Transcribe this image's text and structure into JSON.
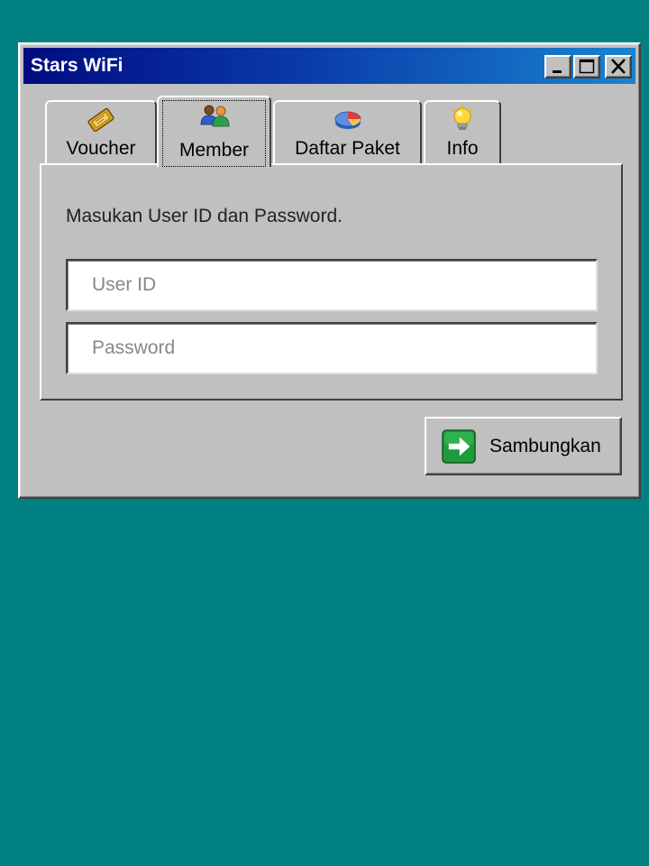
{
  "window": {
    "title": "Stars WiFi"
  },
  "titlebar_buttons": {
    "minimize_icon": "minimize-icon",
    "maximize_icon": "maximize-icon",
    "close_icon": "close-icon"
  },
  "tabs": [
    {
      "label": "Voucher",
      "icon": "ticket-icon",
      "active": false
    },
    {
      "label": "Member",
      "icon": "users-icon",
      "active": true
    },
    {
      "label": "Daftar Paket",
      "icon": "pie-chart-icon",
      "active": false
    },
    {
      "label": "Info",
      "icon": "lightbulb-icon",
      "active": false
    }
  ],
  "form": {
    "instruction": "Masukan User ID dan Password.",
    "user_id": {
      "value": "",
      "placeholder": "User ID"
    },
    "password": {
      "value": "",
      "placeholder": "Password"
    }
  },
  "connect_button": {
    "label": "Sambungkan",
    "icon": "arrow-right-icon"
  },
  "colors": {
    "desktop": "#008080",
    "window_face": "#c0c0c0",
    "title_gradient_start": "#000c80",
    "title_gradient_end": "#1884d0",
    "title_text": "#ffffff",
    "arrow_icon": "#1f9a3c"
  }
}
